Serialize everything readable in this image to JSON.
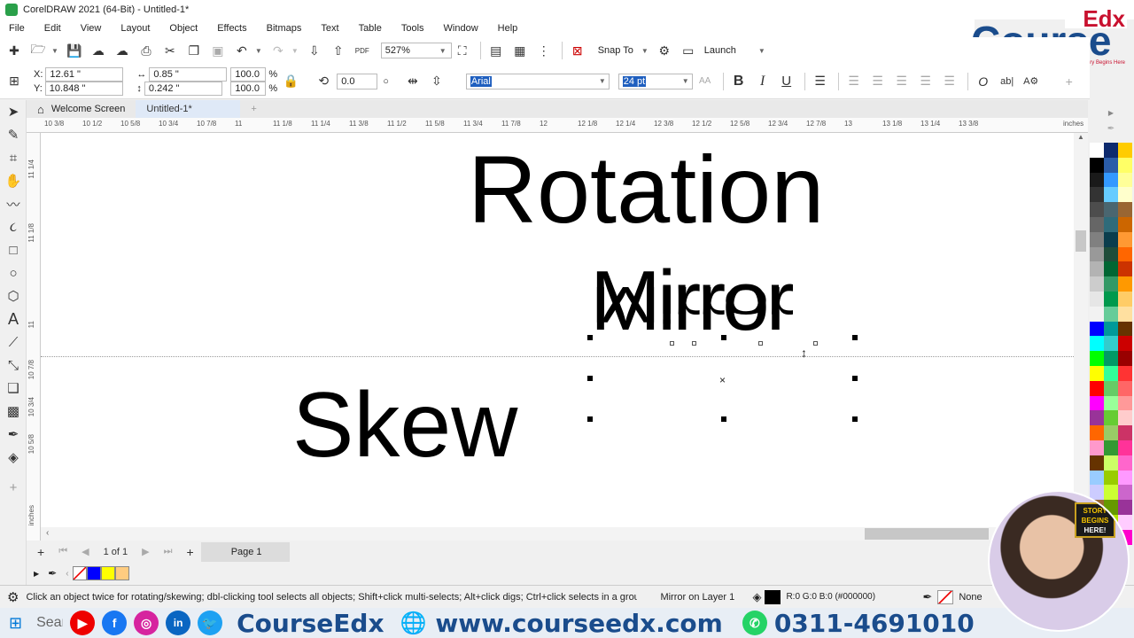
{
  "window": {
    "title": "CorelDRAW 2021 (64-Bit) - Untitled-1*"
  },
  "menu": [
    "File",
    "Edit",
    "View",
    "Layout",
    "Object",
    "Effects",
    "Bitmaps",
    "Text",
    "Table",
    "Tools",
    "Window",
    "Help"
  ],
  "std_toolbar": {
    "zoom": "527%",
    "snap_label": "Snap To",
    "launch_label": "Launch",
    "pdf_label": "PDF"
  },
  "prop_bar": {
    "x": "12.61 \"",
    "y": "10.848 \"",
    "w": "0.85 \"",
    "h": "0.242 \"",
    "scale_x": "100.0",
    "scale_y": "100.0",
    "pct": "%",
    "angle": "0.0",
    "font_name": "Arial",
    "font_size": "24 pt",
    "bold": "B",
    "italic": "I",
    "underline": "U"
  },
  "tabs": {
    "home": "Welcome Screen",
    "doc": "Untitled-1*"
  },
  "ruler": {
    "h_ticks": [
      "10 3/8",
      "10 1/2",
      "10 5/8",
      "10 3/4",
      "10 7/8",
      "11",
      "11 1/8",
      "11 1/4",
      "11 3/8",
      "11 1/2",
      "11 5/8",
      "11 3/4",
      "11 7/8",
      "12",
      "12 1/8",
      "12 1/4",
      "12 3/8",
      "12 1/2",
      "12 5/8",
      "12 3/4",
      "12 7/8",
      "13",
      "13 1/8",
      "13 1/4",
      "13 3/8"
    ],
    "unit": "inches",
    "v_ticks": [
      "11 1/4",
      "11 1/8",
      "11",
      "10 7/8",
      "10 3/4",
      "10 5/8"
    ]
  },
  "canvas": {
    "text1": "Rotation",
    "text2": "Mirror",
    "text3": "Skew"
  },
  "page_nav": {
    "current": "1",
    "of": "of",
    "total": "1",
    "page_tab": "Page 1"
  },
  "status": {
    "hint": "Click an object twice for rotating/skewing; dbl-clicking tool selects all objects; Shift+click multi-selects; Alt+click digs; Ctrl+click selects in a group",
    "object": "Mirror on Layer 1",
    "fill": "R:0 G:0 B:0 (#000000)",
    "outline": "None"
  },
  "logo": {
    "top": "Edx",
    "main": "Course",
    "tagline": "Your Success Story Begins Here"
  },
  "promo": {
    "brand": "CourseEdx",
    "url": "www.courseedx.com",
    "phone": "0311-4691010",
    "search": "Sear"
  },
  "webcam_sign": [
    "STORY",
    "BEGINS",
    "HERE!"
  ],
  "palette": {
    "col1": [
      "#ffffff",
      "#000000",
      "#1a1a1a",
      "#333333",
      "#4d4d4d",
      "#666666",
      "#808080",
      "#999999",
      "#b3b3b3",
      "#cccccc",
      "#e6e6e6",
      "#f2f2f2",
      "#0000ff",
      "#00ffff",
      "#00ff00",
      "#ffff00",
      "#ff0000",
      "#ff00ff",
      "#993399",
      "#ff6600",
      "#ff99cc",
      "#663300",
      "#99ccff",
      "#ccccff",
      "#996633",
      "#ffcc99",
      "#333399"
    ],
    "col2": [
      "#0d2a6e",
      "#2a5ca8",
      "#3399ff",
      "#66ccff",
      "#4a6670",
      "#2f6b7a",
      "#0a3d4d",
      "#1f4d3a",
      "#006633",
      "#339966",
      "#00994d",
      "#66cc99",
      "#009999",
      "#33cccc",
      "#009966",
      "#33ff99",
      "#66cc66",
      "#99ff99",
      "#66cc33",
      "#99cc66",
      "#339933",
      "#ccff66",
      "#99cc00",
      "#ccff33",
      "#669900",
      "#b3e600",
      "#80b300"
    ],
    "col3": [
      "#ffcc00",
      "#ffff66",
      "#ffff99",
      "#ffffcc",
      "#996633",
      "#cc6600",
      "#ff9933",
      "#ff6600",
      "#cc3300",
      "#ff9900",
      "#ffcc66",
      "#ffe0a0",
      "#663300",
      "#cc0000",
      "#990000",
      "#ff3333",
      "#ff6666",
      "#ff9999",
      "#ffcccc",
      "#cc3366",
      "#ff3399",
      "#ff66cc",
      "#ff99ff",
      "#cc66cc",
      "#993399",
      "#ffccff",
      "#ff00cc"
    ]
  },
  "doc_palette": [
    "#0000ff",
    "#ffff00",
    "#ffcc80"
  ]
}
